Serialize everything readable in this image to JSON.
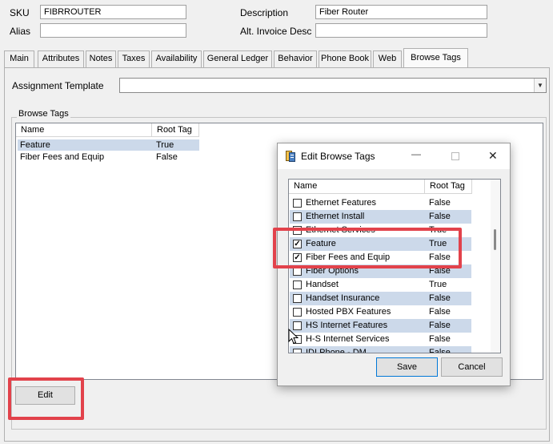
{
  "form": {
    "sku_label": "SKU",
    "sku_value": "FIBRROUTER",
    "alias_label": "Alias",
    "alias_value": "",
    "description_label": "Description",
    "description_value": "Fiber Router",
    "alt_invoice_label": "Alt. Invoice Desc",
    "alt_invoice_value": ""
  },
  "tabs": [
    {
      "label": "Main"
    },
    {
      "label": "Attributes"
    },
    {
      "label": "Notes"
    },
    {
      "label": "Taxes"
    },
    {
      "label": "Availability"
    },
    {
      "label": "General Ledger"
    },
    {
      "label": "Behavior"
    },
    {
      "label": "Phone Book"
    },
    {
      "label": "Web"
    },
    {
      "label": "Browse Tags",
      "active": true
    }
  ],
  "browse_tags_tab": {
    "assignment_template_label": "Assignment Template",
    "assignment_template_value": "",
    "group_label": "Browse Tags",
    "columns": [
      "Name",
      "Root Tag"
    ],
    "rows": [
      {
        "name": "Feature",
        "root_tag": "True",
        "selected": true
      },
      {
        "name": "Fiber Fees and Equip",
        "root_tag": "False",
        "selected": false
      }
    ],
    "edit_button": "Edit"
  },
  "dialog": {
    "title": "Edit Browse Tags",
    "columns": [
      "Name",
      "Root Tag"
    ],
    "rows": [
      {
        "name": "Ethernet Features",
        "root_tag": "False",
        "checked": false
      },
      {
        "name": "Ethernet Install",
        "root_tag": "False",
        "checked": false
      },
      {
        "name": "Ethernet Services",
        "root_tag": "True",
        "checked": false
      },
      {
        "name": "Feature",
        "root_tag": "True",
        "checked": true
      },
      {
        "name": "Fiber Fees and Equip",
        "root_tag": "False",
        "checked": true
      },
      {
        "name": "Fiber Options",
        "root_tag": "False",
        "checked": false
      },
      {
        "name": "Handset",
        "root_tag": "True",
        "checked": false
      },
      {
        "name": "Handset Insurance",
        "root_tag": "False",
        "checked": false
      },
      {
        "name": "Hosted PBX Features",
        "root_tag": "False",
        "checked": false
      },
      {
        "name": "HS Internet Features",
        "root_tag": "False",
        "checked": false
      },
      {
        "name": "H-S Internet Services",
        "root_tag": "False",
        "checked": false
      },
      {
        "name": "IDI Phone - DM",
        "root_tag": "False",
        "checked": false
      }
    ],
    "save_button": "Save",
    "cancel_button": "Cancel",
    "close_glyph": "✕",
    "minimize_glyph": "—"
  },
  "colors": {
    "highlight": "#e2424b",
    "selection": "#ccd9ea",
    "window_bg": "#f0f0f0"
  },
  "icons": {
    "dialog_app_icon": "tag-icon",
    "mouse_pointer": "cursor-icon",
    "checkbox_check": "check-icon"
  }
}
